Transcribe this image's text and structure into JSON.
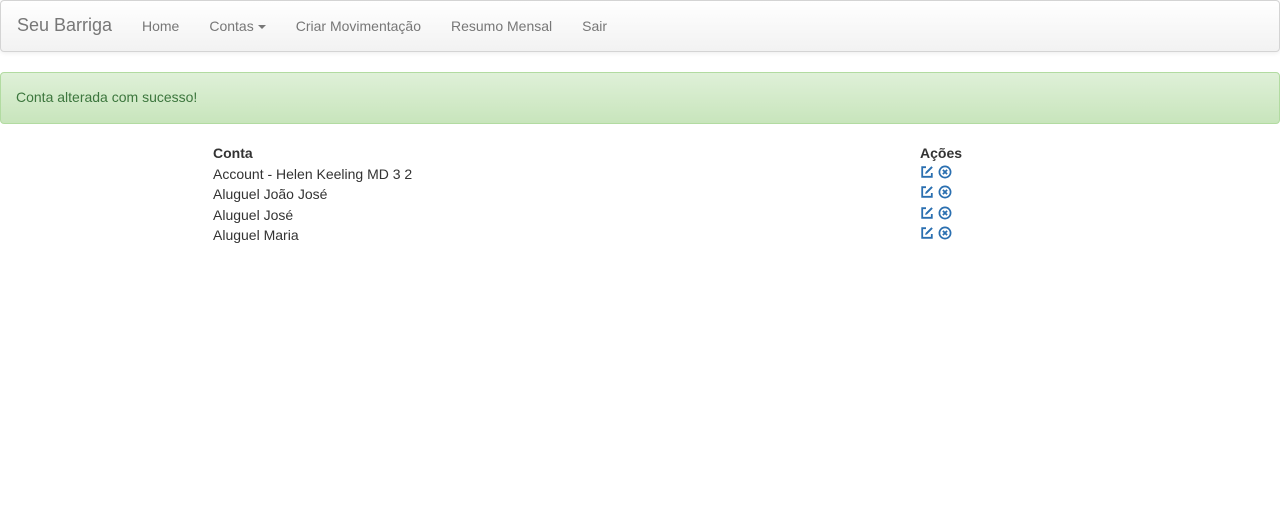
{
  "navbar": {
    "brand": "Seu Barriga",
    "items": [
      {
        "label": "Home"
      },
      {
        "label": "Contas"
      },
      {
        "label": "Criar Movimentação"
      },
      {
        "label": "Resumo Mensal"
      },
      {
        "label": "Sair"
      }
    ]
  },
  "alert": {
    "message": "Conta alterada com sucesso!"
  },
  "table": {
    "headers": [
      "Conta",
      "Ações"
    ],
    "rows": [
      {
        "conta": "Account - Helen Keeling MD 3 2"
      },
      {
        "conta": "Aluguel João José"
      },
      {
        "conta": "Aluguel José"
      },
      {
        "conta": "Aluguel Maria"
      }
    ]
  },
  "icons": {
    "edit": "edit-icon",
    "remove": "remove-circle-icon",
    "color": "#2a6fb0"
  }
}
